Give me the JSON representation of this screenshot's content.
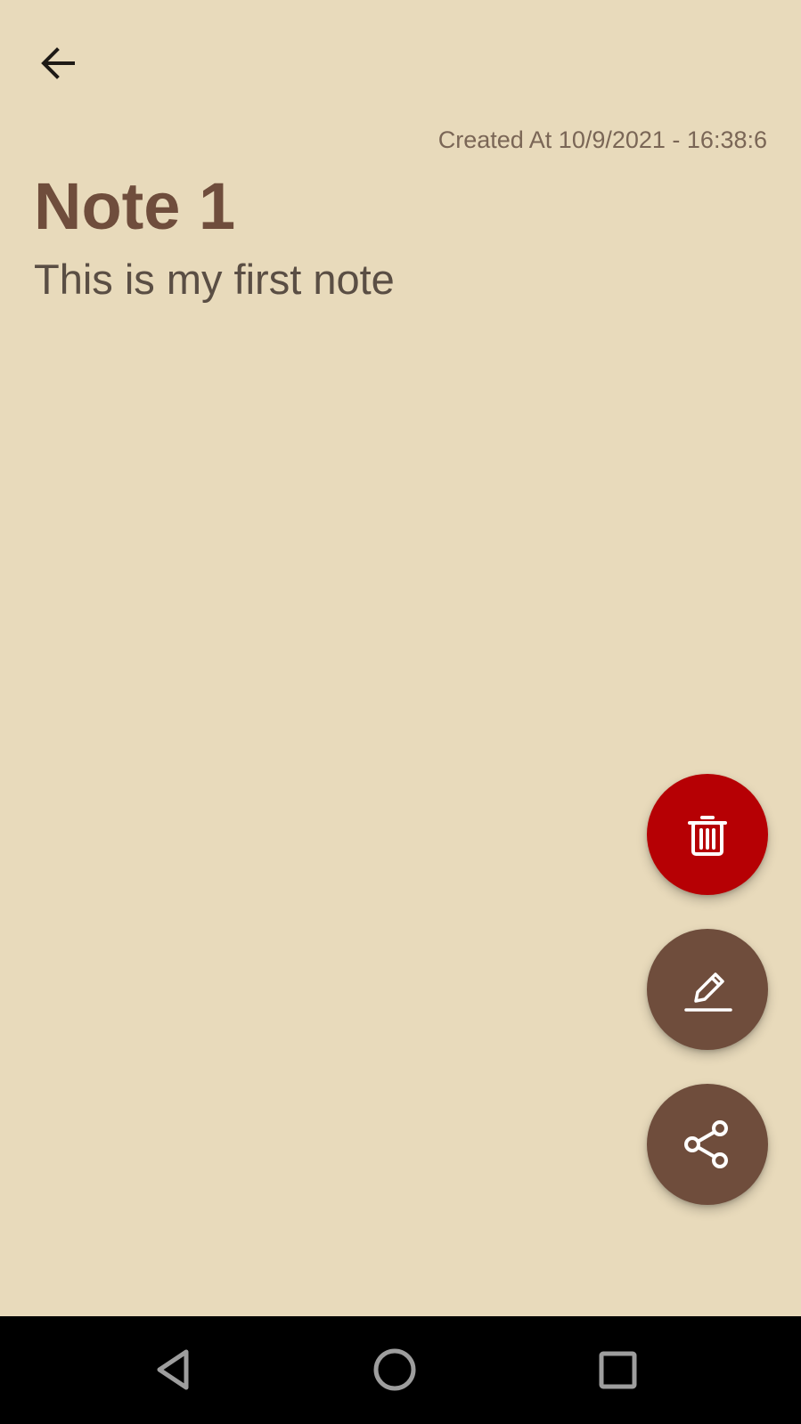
{
  "header": {
    "back_icon": "arrow-left-icon"
  },
  "note": {
    "created_at": "Created At 10/9/2021 - 16:38:6",
    "title": "Note 1",
    "body": "This is my first note"
  },
  "actions": [
    {
      "name": "delete",
      "icon": "trash-icon",
      "color": "#B60004"
    },
    {
      "name": "edit",
      "icon": "pencil-icon",
      "color": "#6F4D3C"
    },
    {
      "name": "share",
      "icon": "share-icon",
      "color": "#6F4D3C"
    }
  ],
  "system_nav": {
    "back_icon": "nav-back-triangle-icon",
    "home_icon": "nav-home-circle-icon",
    "recents_icon": "nav-recents-square-icon"
  },
  "colors": {
    "background": "#E8DABB",
    "title": "#6F4D3C",
    "accent_delete": "#B60004",
    "accent_primary": "#6F4D3C"
  }
}
